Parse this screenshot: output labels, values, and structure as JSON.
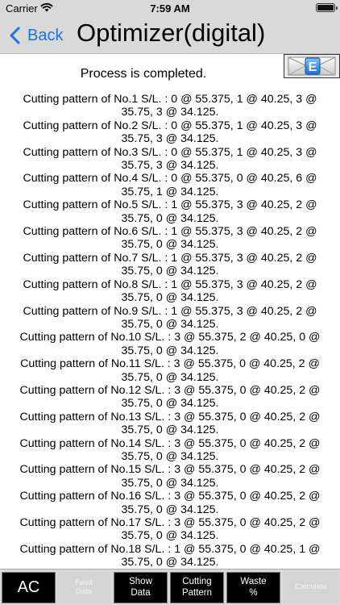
{
  "status_bar": {
    "carrier": "Carrier",
    "time": "7:59 AM"
  },
  "nav": {
    "back_label": "Back",
    "title": "Optimizer(digital)"
  },
  "message": "Process is completed.",
  "patterns": [
    {
      "line1": "Cutting pattern of No.1  S/L. : 0 @ 55.375, 1 @ 40.25, 3 @",
      "line2": "35.75, 3 @ 34.125."
    },
    {
      "line1": "Cutting pattern of No.2  S/L. : 0 @ 55.375, 1 @ 40.25, 3 @",
      "line2": "35.75, 3 @ 34.125."
    },
    {
      "line1": "Cutting pattern of No.3  S/L. : 0 @ 55.375, 1 @ 40.25, 3 @",
      "line2": "35.75, 3 @ 34.125."
    },
    {
      "line1": "Cutting pattern of No.4  S/L. : 0 @ 55.375, 0 @ 40.25, 6 @",
      "line2": "35.75, 1 @ 34.125."
    },
    {
      "line1": "Cutting pattern of No.5  S/L. : 1 @ 55.375, 3 @ 40.25, 2 @",
      "line2": "35.75, 0 @ 34.125."
    },
    {
      "line1": "Cutting pattern of No.6  S/L. : 1 @ 55.375, 3 @ 40.25, 2 @",
      "line2": "35.75, 0 @ 34.125."
    },
    {
      "line1": "Cutting pattern of No.7  S/L. : 1 @ 55.375, 3 @ 40.25, 2 @",
      "line2": "35.75, 0 @ 34.125."
    },
    {
      "line1": "Cutting pattern of No.8  S/L. : 1 @ 55.375, 3 @ 40.25, 2 @",
      "line2": "35.75, 0 @ 34.125."
    },
    {
      "line1": "Cutting pattern of No.9  S/L. : 1 @ 55.375, 3 @ 40.25, 2 @",
      "line2": "35.75, 0 @ 34.125."
    },
    {
      "line1": "Cutting pattern of No.10  S/L. : 3 @ 55.375, 2 @ 40.25, 0 @",
      "line2": "35.75, 0 @ 34.125."
    },
    {
      "line1": "Cutting pattern of No.11  S/L. : 3 @ 55.375, 0 @ 40.25, 2 @",
      "line2": "35.75, 0 @ 34.125."
    },
    {
      "line1": "Cutting pattern of No.12  S/L. : 3 @ 55.375, 0 @ 40.25, 2 @",
      "line2": "35.75, 0 @ 34.125."
    },
    {
      "line1": "Cutting pattern of No.13  S/L. : 3 @ 55.375, 0 @ 40.25, 2 @",
      "line2": "35.75, 0 @ 34.125."
    },
    {
      "line1": "Cutting pattern of No.14  S/L. : 3 @ 55.375, 0 @ 40.25, 2 @",
      "line2": "35.75, 0 @ 34.125."
    },
    {
      "line1": "Cutting pattern of No.15  S/L. : 3 @ 55.375, 0 @ 40.25, 2 @",
      "line2": "35.75, 0 @ 34.125."
    },
    {
      "line1": "Cutting pattern of No.16  S/L. : 3 @ 55.375, 0 @ 40.25, 2 @",
      "line2": "35.75, 0 @ 34.125."
    },
    {
      "line1": "Cutting pattern of No.17  S/L. : 3 @ 55.375, 0 @ 40.25, 2 @",
      "line2": "35.75, 0 @ 34.125."
    },
    {
      "line1": "Cutting pattern of No.18  S/L. : 1 @ 55.375, 0 @ 40.25, 1 @",
      "line2": "35.75, 0 @ 34.125."
    }
  ],
  "toolbar": {
    "ac": "AC",
    "feed_data": [
      "Feed",
      "Data"
    ],
    "show_data": [
      "Show",
      "Data"
    ],
    "cutting_pattern": [
      "Cutting",
      "Pattern"
    ],
    "waste": [
      "Waste",
      "%"
    ],
    "calculate": "Calculate"
  },
  "icons": {
    "mail": "mail-envelope-icon",
    "back": "chevron-left-icon",
    "wifi": "wifi-icon",
    "battery": "battery-icon"
  },
  "colors": {
    "bar_bg": "#d9d9d9",
    "link_blue": "#1a73e8",
    "button_dark": "#000000"
  }
}
